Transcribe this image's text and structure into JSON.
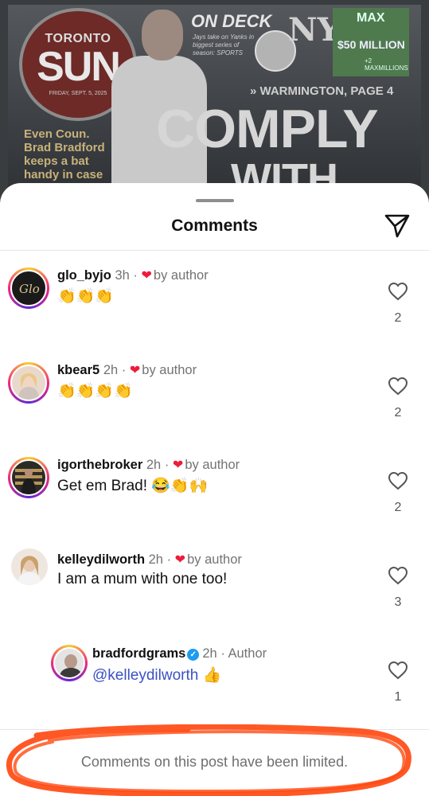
{
  "background_image": {
    "logo_top": "TORONTO",
    "logo_main": "SUN",
    "logo_date": "FRIDAY, SEPT. 5, 2025",
    "on_deck": "ON DECK",
    "on_deck_sub": "Jays take on Yanks in biggest series of season: SPORTS",
    "lottery_brand": "MAX",
    "lottery_amount": "$50 MILLION",
    "lottery_plus": "+2 MAXMILLIONS",
    "warmington": "» WARMINGTON, PAGE 4",
    "headline_1": "COMPLY",
    "headline_2": "WITH",
    "side_story": "Even Coun. Brad Bradford keeps a bat handy in case"
  },
  "sheet": {
    "title": "Comments"
  },
  "comments": [
    {
      "username": "glo_byjo",
      "time": "3h",
      "separator": "·",
      "liked_label": "by author",
      "text": "👏👏👏",
      "likes": "2"
    },
    {
      "username": "kbear5",
      "time": "2h",
      "separator": "·",
      "liked_label": "by author",
      "text": "👏👏👏👏",
      "likes": "2"
    },
    {
      "username": "igorthebroker",
      "time": "2h",
      "separator": "·",
      "liked_label": "by author",
      "text": "Get em Brad! 😂👏🙌",
      "likes": "2"
    },
    {
      "username": "kelleydilworth",
      "time": "2h",
      "separator": "·",
      "liked_label": "by author",
      "text": "I am a mum with one too!",
      "likes": "3"
    }
  ],
  "reply": {
    "username": "bradfordgrams",
    "verified_mark": "✓",
    "time": "2h",
    "separator": "·",
    "badge": "Author",
    "mention": "@kelleydilworth",
    "emoji": "👍",
    "likes": "1"
  },
  "footer": {
    "limited_text": "Comments on this post have been limited."
  },
  "colors": {
    "heart_red": "#ed1c3b",
    "mention_blue": "#3b51c4",
    "verified_blue": "#1d9bf0",
    "scribble_orange": "#ff4a12"
  }
}
